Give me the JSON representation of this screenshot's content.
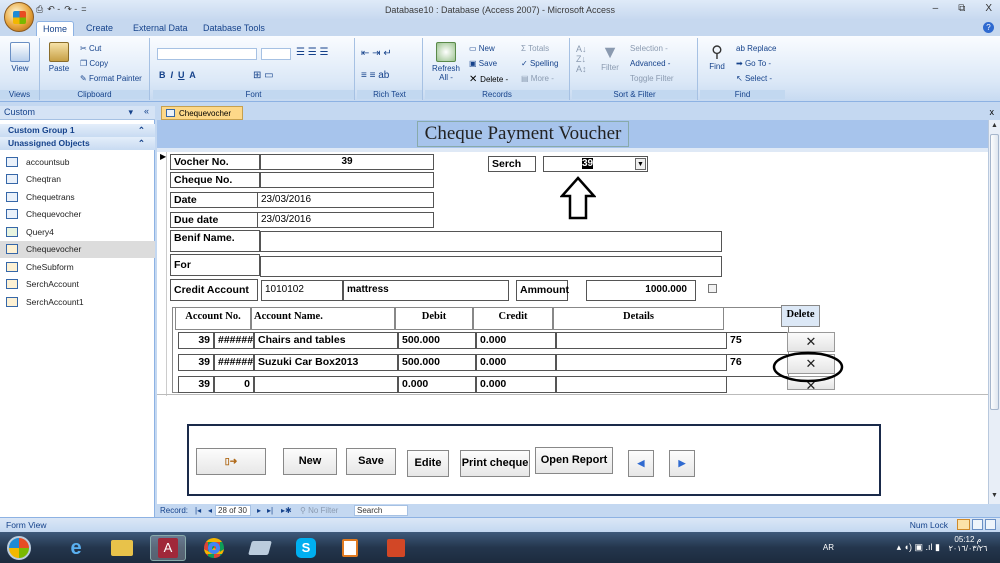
{
  "window": {
    "title": "Database10 : Database (Access 2007) - Microsoft Access",
    "qat": [
      "⎙",
      "↶ -",
      "↷ -",
      "="
    ],
    "controls": [
      "–",
      "⧉",
      "X"
    ]
  },
  "ribbon_tabs": [
    "Home",
    "Create",
    "External Data",
    "Database Tools"
  ],
  "ribbon": {
    "views": {
      "view_label": "View",
      "group": "Views"
    },
    "clipboard": {
      "paste": "Paste",
      "cut": "Cut",
      "copy": "Copy",
      "format_painter": "Format Painter",
      "group": "Clipboard"
    },
    "font": {
      "group": "Font",
      "bold": "B",
      "italic": "I",
      "underline": "U",
      "font_color": "A"
    },
    "rich_text": {
      "group": "Rich Text"
    },
    "records": {
      "refresh": "Refresh",
      "refresh2": "All -",
      "new": "New",
      "save": "Save",
      "delete": "Delete -",
      "totals": "Totals",
      "spelling": "Spelling",
      "more": "More -",
      "group": "Records"
    },
    "sort_filter": {
      "filter": "Filter",
      "selection": "Selection -",
      "advanced": "Advanced -",
      "toggle": "Toggle Filter",
      "group": "Sort & Filter"
    },
    "find": {
      "find": "Find",
      "replace": "Replace",
      "goto": "Go To -",
      "select": "Select -",
      "group": "Find"
    }
  },
  "nav": {
    "header": "Custom",
    "groups": [
      "Custom Group 1",
      "Unassigned Objects"
    ],
    "items": [
      {
        "label": "accountsub",
        "type": "table"
      },
      {
        "label": "Cheqtran",
        "type": "table"
      },
      {
        "label": "Chequetrans",
        "type": "table"
      },
      {
        "label": "Chequevocher",
        "type": "table"
      },
      {
        "label": "Query4",
        "type": "query"
      },
      {
        "label": "Chequevocher",
        "type": "form",
        "selected": true
      },
      {
        "label": "CheSubform",
        "type": "form"
      },
      {
        "label": "SerchAccount",
        "type": "form"
      },
      {
        "label": "SerchAccount1",
        "type": "form"
      }
    ]
  },
  "doc_tab": "Chequevocher",
  "form": {
    "title": "Cheque Payment Voucher",
    "fields": {
      "vocher_no": {
        "label": "Vocher No.",
        "value": "39"
      },
      "cheque_no": {
        "label": "Cheque No.",
        "value": ""
      },
      "date": {
        "label": "Date",
        "value": "23/03/2016"
      },
      "due_date": {
        "label": "Due date",
        "value": "23/03/2016"
      },
      "benif_name": {
        "label": "Benif Name.",
        "value": ""
      },
      "for": {
        "label": "For",
        "value": ""
      },
      "credit_account": {
        "label": "Credit Account",
        "code": "1010102",
        "name": "mattress"
      },
      "ammount": {
        "label": "Ammount",
        "value": "1000.000"
      },
      "serch": {
        "label": "Serch",
        "value": "39"
      }
    },
    "subform": {
      "headers": [
        "Account No.",
        "Account Name.",
        "Debit",
        "Credit",
        "Details"
      ],
      "delete_header": "Delete",
      "rows": [
        {
          "vno": "39",
          "acct": "#######",
          "name": "Chairs and tables",
          "debit": "500.000",
          "credit": "0.000",
          "details": "",
          "id": "75"
        },
        {
          "vno": "39",
          "acct": "#######",
          "name": "Suzuki Car Box2013",
          "debit": "500.000",
          "credit": "0.000",
          "details": "",
          "id": "76"
        },
        {
          "vno": "39",
          "acct": "0",
          "name": "",
          "debit": "0.000",
          "credit": "0.000",
          "details": "",
          "id": ""
        }
      ],
      "delete_symbol": "✕"
    },
    "buttons": {
      "new": "New",
      "save": "Save",
      "edite": "Edite",
      "print": "Print cheque",
      "report": "Open Report",
      "prev": "◀",
      "next": "▶"
    }
  },
  "record_nav": {
    "label": "Record:",
    "position": "28 of 30",
    "filter": "No Filter",
    "search": "Search"
  },
  "status": {
    "left": "Form View",
    "right": "Num Lock"
  },
  "tray": {
    "lang": "AR",
    "time": "05:12 م",
    "date": "٢٠١٦/٠٣/٢٦"
  },
  "colors": {
    "ribbon": "#dbe8f7",
    "form_header": "#a7c4ec",
    "tab_active": "#fdd889",
    "annotation": "#000000"
  }
}
